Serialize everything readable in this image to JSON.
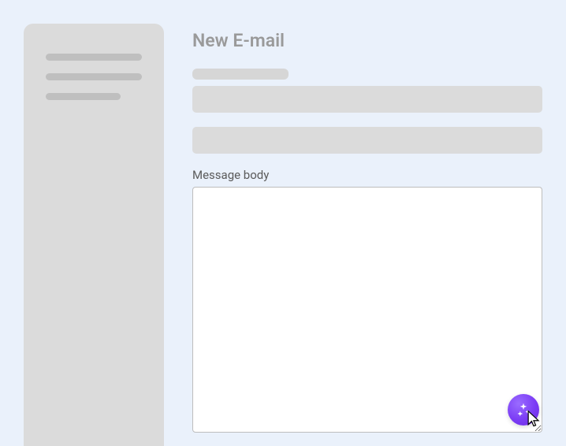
{
  "page_title": "New E-mail",
  "message_body_label": "Message body",
  "message_body_value": "",
  "ai_button_name": "sparkle-icon",
  "colors": {
    "background": "#eaf1fb",
    "skeleton": "#dbdbdb",
    "skeleton_inner": "#bfbfbf",
    "accent_purple": "#7b3cf5"
  }
}
